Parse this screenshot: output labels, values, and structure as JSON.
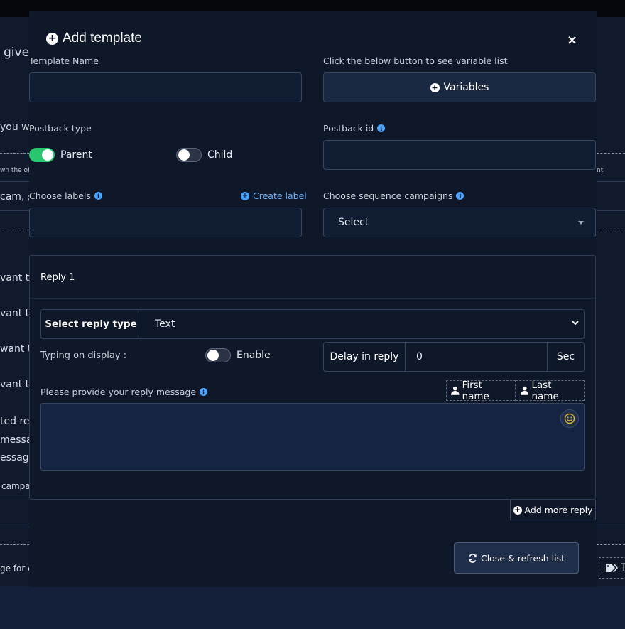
{
  "background": {
    "texts": [
      "give",
      "you wa",
      "cam, چ",
      "vant to",
      "vant to",
      "want to",
      "vant to",
      "ted rep",
      "messag",
      "essage",
      "campa",
      "ge for c"
    ],
    "small_texts": [
      "wn the of",
      "nt"
    ],
    "tag_button_label": "T"
  },
  "modal": {
    "title": "Add template",
    "close_label": "×",
    "template_name": {
      "label": "Template Name",
      "value": "",
      "placeholder": ""
    },
    "variables_hint": "Click the below button to see variable list",
    "variables_button": "Variables",
    "postback_type": {
      "label": "Postback type",
      "options": [
        {
          "label": "Parent",
          "on": true
        },
        {
          "label": "Child",
          "on": false
        }
      ]
    },
    "postback_id": {
      "label": "Postback id",
      "value": ""
    },
    "labels": {
      "label": "Choose labels",
      "create_label": "Create label",
      "value": ""
    },
    "sequence": {
      "label": "Choose sequence campaigns",
      "selected": "Select"
    },
    "reply": {
      "title": "Reply 1",
      "reply_type_label": "Select reply type",
      "reply_type_value": "Text",
      "typing_label": "Typing on display :",
      "typing_toggle_label": "Enable",
      "typing_on": false,
      "delay_label": "Delay in reply",
      "delay_value": "0",
      "delay_unit": "Sec",
      "message_label": "Please provide your reply message",
      "first_name_button": "First name",
      "last_name_button": "Last name",
      "message_value": ""
    },
    "add_more_reply": "Add more reply",
    "close_refresh": "Close & refresh list"
  },
  "colors": {
    "accent_blue": "#4aa3ff",
    "toggle_on": "#28c76f",
    "modal_bg": "#0f1829"
  }
}
